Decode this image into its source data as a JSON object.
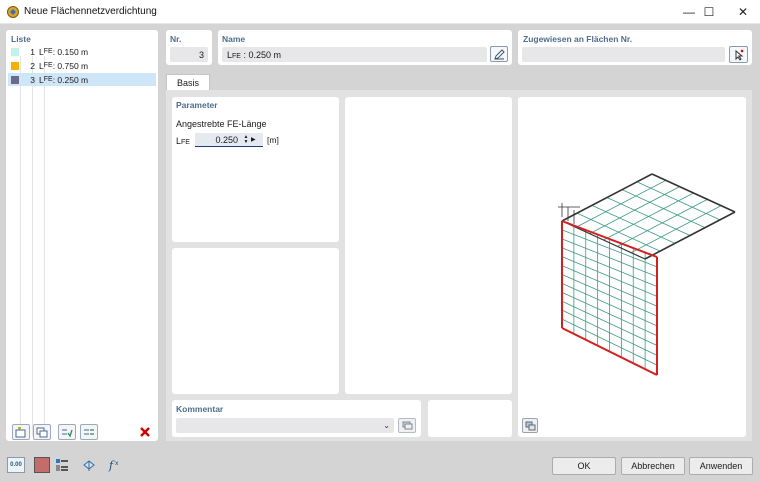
{
  "window": {
    "title": "Neue Flächennetzverdichtung",
    "minimize": "—",
    "maximize": "☐",
    "close": "✕"
  },
  "list": {
    "title": "Liste",
    "items": [
      {
        "num": "1",
        "prefix": "L",
        "sub": "FE",
        "value": " : 0.150 m",
        "color": "#bff3ee"
      },
      {
        "num": "2",
        "prefix": "L",
        "sub": "FE",
        "value": " : 0.750 m",
        "color": "#f5b100"
      },
      {
        "num": "3",
        "prefix": "L",
        "sub": "FE",
        "value": " : 0.250 m",
        "color": "#6a6a8a"
      }
    ],
    "selected_index": 2
  },
  "nr": {
    "label": "Nr.",
    "value": "3"
  },
  "name": {
    "label": "Name",
    "prefix": "L",
    "sub": "FE",
    "value": " : 0.250 m"
  },
  "assigned": {
    "label": "Zugewiesen an Flächen Nr.",
    "value": ""
  },
  "tabs": [
    {
      "label": "Basis",
      "active": true
    }
  ],
  "parameter": {
    "title": "Parameter",
    "section_label": "Angestrebte FE-Länge",
    "symbol_prefix": "L",
    "symbol_sub": "FE",
    "value": "0.250",
    "unit": "[m]"
  },
  "comment": {
    "title": "Kommentar",
    "value": ""
  },
  "buttons": {
    "ok": "OK",
    "cancel": "Abbrechen",
    "apply": "Anwenden"
  },
  "bottom_tools": {
    "units_label": "0.00"
  },
  "colors": {
    "accent_title": "#4f6d8f",
    "selection": "#cfe6f8",
    "mesh_green": "#3c9a86",
    "edge_red": "#d32020",
    "delete_red": "#d40000"
  }
}
